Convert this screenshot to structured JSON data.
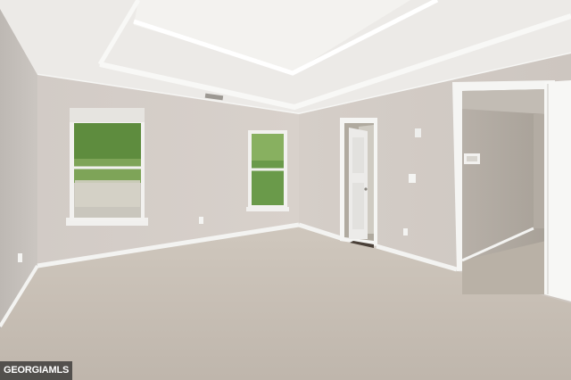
{
  "photo": {
    "watermark": "GEORGIAMLS"
  },
  "colors": {
    "wall_left": "#c9c4c0",
    "wall_back": "#d3ccc7",
    "wall_right": "#cfc8c2",
    "ceiling": "#ecebe8",
    "carpet": "#c7beb4",
    "trim": "#f4f4f2",
    "foliage": "#6a9a4a"
  },
  "icons": {
    "watermark_logo": "mls-logo-icon"
  }
}
